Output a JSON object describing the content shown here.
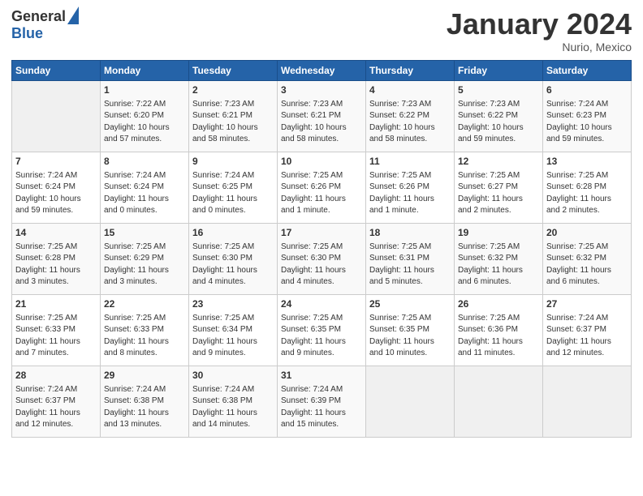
{
  "logo": {
    "general": "General",
    "blue": "Blue"
  },
  "title": {
    "month": "January 2024",
    "location": "Nurio, Mexico"
  },
  "header_days": [
    "Sunday",
    "Monday",
    "Tuesday",
    "Wednesday",
    "Thursday",
    "Friday",
    "Saturday"
  ],
  "weeks": [
    [
      {
        "day": "",
        "info": ""
      },
      {
        "day": "1",
        "info": "Sunrise: 7:22 AM\nSunset: 6:20 PM\nDaylight: 10 hours\nand 57 minutes."
      },
      {
        "day": "2",
        "info": "Sunrise: 7:23 AM\nSunset: 6:21 PM\nDaylight: 10 hours\nand 58 minutes."
      },
      {
        "day": "3",
        "info": "Sunrise: 7:23 AM\nSunset: 6:21 PM\nDaylight: 10 hours\nand 58 minutes."
      },
      {
        "day": "4",
        "info": "Sunrise: 7:23 AM\nSunset: 6:22 PM\nDaylight: 10 hours\nand 58 minutes."
      },
      {
        "day": "5",
        "info": "Sunrise: 7:23 AM\nSunset: 6:22 PM\nDaylight: 10 hours\nand 59 minutes."
      },
      {
        "day": "6",
        "info": "Sunrise: 7:24 AM\nSunset: 6:23 PM\nDaylight: 10 hours\nand 59 minutes."
      }
    ],
    [
      {
        "day": "7",
        "info": "Sunrise: 7:24 AM\nSunset: 6:24 PM\nDaylight: 10 hours\nand 59 minutes."
      },
      {
        "day": "8",
        "info": "Sunrise: 7:24 AM\nSunset: 6:24 PM\nDaylight: 11 hours\nand 0 minutes."
      },
      {
        "day": "9",
        "info": "Sunrise: 7:24 AM\nSunset: 6:25 PM\nDaylight: 11 hours\nand 0 minutes."
      },
      {
        "day": "10",
        "info": "Sunrise: 7:25 AM\nSunset: 6:26 PM\nDaylight: 11 hours\nand 1 minute."
      },
      {
        "day": "11",
        "info": "Sunrise: 7:25 AM\nSunset: 6:26 PM\nDaylight: 11 hours\nand 1 minute."
      },
      {
        "day": "12",
        "info": "Sunrise: 7:25 AM\nSunset: 6:27 PM\nDaylight: 11 hours\nand 2 minutes."
      },
      {
        "day": "13",
        "info": "Sunrise: 7:25 AM\nSunset: 6:28 PM\nDaylight: 11 hours\nand 2 minutes."
      }
    ],
    [
      {
        "day": "14",
        "info": "Sunrise: 7:25 AM\nSunset: 6:28 PM\nDaylight: 11 hours\nand 3 minutes."
      },
      {
        "day": "15",
        "info": "Sunrise: 7:25 AM\nSunset: 6:29 PM\nDaylight: 11 hours\nand 3 minutes."
      },
      {
        "day": "16",
        "info": "Sunrise: 7:25 AM\nSunset: 6:30 PM\nDaylight: 11 hours\nand 4 minutes."
      },
      {
        "day": "17",
        "info": "Sunrise: 7:25 AM\nSunset: 6:30 PM\nDaylight: 11 hours\nand 4 minutes."
      },
      {
        "day": "18",
        "info": "Sunrise: 7:25 AM\nSunset: 6:31 PM\nDaylight: 11 hours\nand 5 minutes."
      },
      {
        "day": "19",
        "info": "Sunrise: 7:25 AM\nSunset: 6:32 PM\nDaylight: 11 hours\nand 6 minutes."
      },
      {
        "day": "20",
        "info": "Sunrise: 7:25 AM\nSunset: 6:32 PM\nDaylight: 11 hours\nand 6 minutes."
      }
    ],
    [
      {
        "day": "21",
        "info": "Sunrise: 7:25 AM\nSunset: 6:33 PM\nDaylight: 11 hours\nand 7 minutes."
      },
      {
        "day": "22",
        "info": "Sunrise: 7:25 AM\nSunset: 6:33 PM\nDaylight: 11 hours\nand 8 minutes."
      },
      {
        "day": "23",
        "info": "Sunrise: 7:25 AM\nSunset: 6:34 PM\nDaylight: 11 hours\nand 9 minutes."
      },
      {
        "day": "24",
        "info": "Sunrise: 7:25 AM\nSunset: 6:35 PM\nDaylight: 11 hours\nand 9 minutes."
      },
      {
        "day": "25",
        "info": "Sunrise: 7:25 AM\nSunset: 6:35 PM\nDaylight: 11 hours\nand 10 minutes."
      },
      {
        "day": "26",
        "info": "Sunrise: 7:25 AM\nSunset: 6:36 PM\nDaylight: 11 hours\nand 11 minutes."
      },
      {
        "day": "27",
        "info": "Sunrise: 7:24 AM\nSunset: 6:37 PM\nDaylight: 11 hours\nand 12 minutes."
      }
    ],
    [
      {
        "day": "28",
        "info": "Sunrise: 7:24 AM\nSunset: 6:37 PM\nDaylight: 11 hours\nand 12 minutes."
      },
      {
        "day": "29",
        "info": "Sunrise: 7:24 AM\nSunset: 6:38 PM\nDaylight: 11 hours\nand 13 minutes."
      },
      {
        "day": "30",
        "info": "Sunrise: 7:24 AM\nSunset: 6:38 PM\nDaylight: 11 hours\nand 14 minutes."
      },
      {
        "day": "31",
        "info": "Sunrise: 7:24 AM\nSunset: 6:39 PM\nDaylight: 11 hours\nand 15 minutes."
      },
      {
        "day": "",
        "info": ""
      },
      {
        "day": "",
        "info": ""
      },
      {
        "day": "",
        "info": ""
      }
    ]
  ]
}
